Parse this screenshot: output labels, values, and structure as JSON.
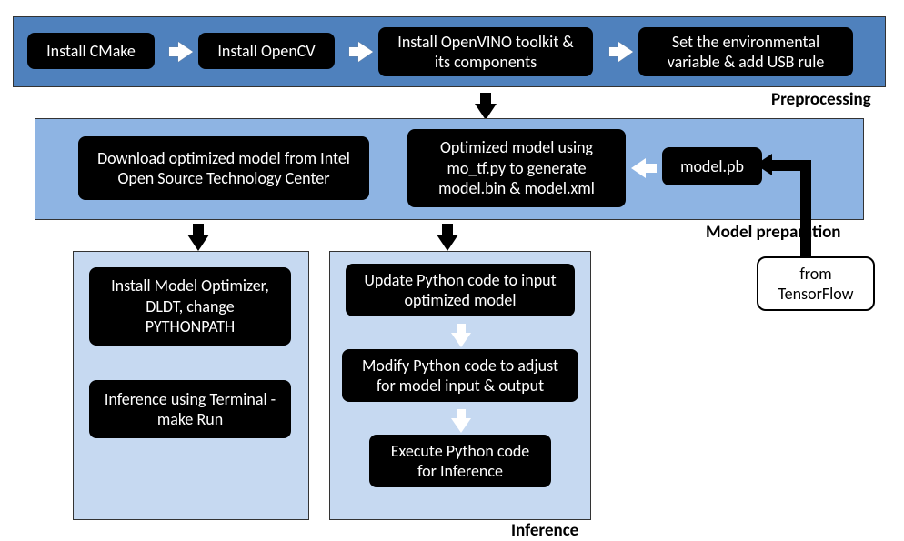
{
  "stages": {
    "preprocessing": {
      "label": "Preprocessing",
      "boxes": {
        "b1": "Install CMake",
        "b2": "Install OpenCV",
        "b3": "Install OpenVINO toolkit & its components",
        "b4": "Set the environmental variable & add USB rule"
      }
    },
    "model_prep": {
      "label": "Model preparation",
      "boxes": {
        "b5": "Download optimized model from Intel Open Source Technology Center",
        "b6": "Optimized model using mo_tf.py to generate model.bin & model.xml",
        "b7": "model.pb"
      }
    },
    "inference_left": {
      "boxes": {
        "b8": "Install Model Optimizer, DLDT, change PYTHONPATH",
        "b9": "Inference using Terminal - make Run"
      }
    },
    "inference_right": {
      "label": "Inference",
      "boxes": {
        "b10": "Update Python code to input optimized model",
        "b11": "Modify Python code to adjust for model input & output",
        "b12": "Execute Python code for Inference"
      }
    },
    "external": {
      "b13": "from TensorFlow"
    }
  },
  "colors": {
    "stage_preproc": "#4f81bd",
    "stage_modelprep": "#8eb4e3",
    "stage_inference": "#c6d9f1"
  }
}
